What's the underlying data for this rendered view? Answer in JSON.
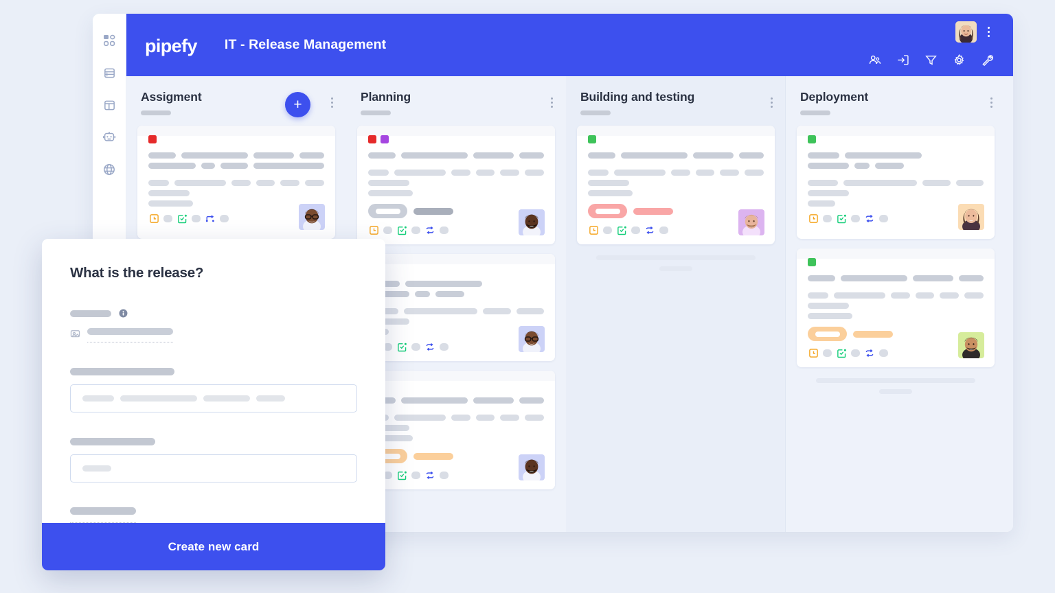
{
  "app": {
    "brand": "pipefy",
    "board_title": "IT - Release Management",
    "accent_color": "#3d50ee",
    "page_background": "#eaeff8",
    "board_background": "#eef2fa"
  },
  "sidebar": {
    "items": [
      {
        "icon": "dashboard-grid-icon",
        "name": "sidebar-item-dashboard"
      },
      {
        "icon": "database-icon",
        "name": "sidebar-item-database"
      },
      {
        "icon": "layout-icon",
        "name": "sidebar-item-layout"
      },
      {
        "icon": "robot-icon",
        "name": "sidebar-item-automations"
      },
      {
        "icon": "globe-icon",
        "name": "sidebar-item-portal"
      }
    ]
  },
  "topbar": {
    "avatar": {
      "name": "user-avatar",
      "alt": "account avatar"
    },
    "kebab": "more-options",
    "tools": [
      {
        "icon": "members-icon",
        "name": "members-button"
      },
      {
        "icon": "import-icon",
        "name": "import-button"
      },
      {
        "icon": "filter-icon",
        "name": "filter-button"
      },
      {
        "icon": "gear-icon",
        "name": "settings-button"
      },
      {
        "icon": "wrench-icon",
        "name": "tools-button"
      }
    ]
  },
  "board": {
    "add_card_label": "+",
    "columns": [
      {
        "title": "Assigment",
        "highlight": false,
        "has_add_button": true,
        "ghost_rows": 0,
        "cards": [
          {
            "labels": [
              "#e52a2a"
            ],
            "avatar_bg": "#ccd2f7",
            "avatar_skin": "#7a4b30",
            "due": null,
            "rows": [
              [
                46,
                112,
                68,
                42
              ],
              [
                75,
                22,
                44,
                113
              ],
              [
                46,
                112,
                42,
                42,
                42,
                42
              ],
              [
                60
              ],
              [
                65
              ]
            ],
            "footer_icons": [
              "clock-box-icon",
              "checklist-box-icon",
              "flow-connector-icon"
            ]
          }
        ]
      },
      {
        "title": "Planning",
        "highlight": false,
        "has_add_button": false,
        "ghost_rows": 0,
        "cards": [
          {
            "labels": [
              "#e52a2a",
              "#a546e0"
            ],
            "avatar_bg": "#ccd2f7",
            "avatar_skin": "#5b3420",
            "due": "gray",
            "rows": [
              [
                46,
                112,
                68,
                42
              ],
              [
                46,
                112,
                42,
                42,
                42,
                42
              ],
              [
                60
              ],
              [
                65
              ]
            ],
            "footer_icons": [
              "clock-box-icon",
              "checklist-box-icon",
              "repeat-icon"
            ]
          },
          {
            "labels": [
              "#e52a2a"
            ],
            "avatar_bg": "#ccd2f7",
            "avatar_skin": "#6d4228",
            "due": null,
            "rows": [
              [
                46,
                112
              ],
              [
                60,
                22,
                42
              ],
              [
                46,
                112,
                42,
                42
              ],
              [
                60
              ],
              [
                30
              ]
            ],
            "footer_icons": [
              "clock-box-icon",
              "checklist-box-icon",
              "repeat-icon"
            ]
          },
          {
            "labels": [
              "#e52a2a"
            ],
            "avatar_bg": "#ccd2f7",
            "avatar_skin": "#5b3420",
            "due": "amber",
            "rows": [
              [
                46,
                112,
                68,
                42
              ],
              [
                46,
                112,
                42,
                42,
                42,
                42
              ],
              [
                60
              ],
              [
                65
              ]
            ],
            "footer_icons": [
              "clock-box-icon",
              "checklist-box-icon",
              "repeat-icon"
            ]
          }
        ]
      },
      {
        "title": "Building and testing",
        "highlight": true,
        "has_add_button": false,
        "ghost_rows": 2,
        "cards": [
          {
            "labels": [
              "#3ec35a"
            ],
            "avatar_bg": "#dcb4f0",
            "avatar_skin": "#e8b49c",
            "due": "red",
            "rows": [
              [
                46,
                112,
                68,
                42
              ],
              [
                46,
                112,
                42,
                42,
                42,
                42
              ],
              [
                60
              ],
              [
                65
              ]
            ],
            "footer_icons": [
              "clock-box-icon",
              "checklist-box-icon",
              "repeat-icon"
            ]
          }
        ]
      },
      {
        "title": "Deployment",
        "highlight": false,
        "has_add_button": false,
        "ghost_rows": 2,
        "cards": [
          {
            "labels": [
              "#3ec35a"
            ],
            "avatar_bg": "#fbdcb4",
            "avatar_skin": "#e8b49c",
            "due": null,
            "rows": [
              [
                46,
                112
              ],
              [
                60,
                22,
                42
              ],
              [
                46,
                112,
                42,
                42
              ],
              [
                60
              ],
              [
                40
              ]
            ],
            "footer_icons": [
              "clock-box-icon",
              "checklist-box-icon",
              "repeat-icon"
            ]
          },
          {
            "labels": [
              "#3ec35a"
            ],
            "avatar_bg": "#d6ec9b",
            "avatar_skin": "#c98f62",
            "due": "amber",
            "rows": [
              [
                46,
                112,
                68,
                42
              ],
              [
                46,
                112,
                42,
                42,
                42,
                42
              ],
              [
                60
              ],
              [
                65
              ]
            ],
            "footer_icons": [
              "clock-box-icon",
              "checklist-box-icon",
              "repeat-icon"
            ]
          }
        ]
      }
    ]
  },
  "modal": {
    "title": "What is the release?",
    "cta_label": "Create new card",
    "info_icon": "info-icon",
    "attachment_icon": "image-attachment-icon",
    "field_one_chips": [
      46,
      112,
      68,
      42
    ],
    "field_two_chips": [
      42
    ]
  }
}
